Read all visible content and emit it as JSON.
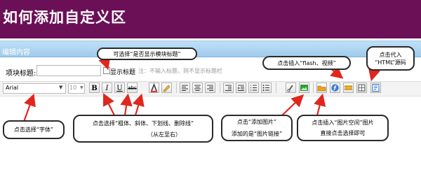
{
  "header": {
    "title": "如何添加自定义区"
  },
  "panel": {
    "tab_label": "编辑内容"
  },
  "form": {
    "title_label": "项块标题:",
    "title_value": "",
    "show_title_label": "显示标题",
    "show_title_checked": false,
    "note": "注：不输入标题，则不显示标题栏"
  },
  "toolbar": {
    "font_value": "Arial",
    "size_value": "10",
    "bold": "B",
    "italic": "I",
    "underline": "U",
    "strike": "abc"
  },
  "callouts": {
    "show_title": "可选择“是否显示模块标题”",
    "insert_flash": "点击插入“flash、视频”",
    "insert_html_1": "点击代入",
    "insert_html_2": "“HTML”源码",
    "font_select": "点击选择“字体”",
    "text_style_1": "点击选择“粗体、斜体、下划线、删除线”",
    "text_style_2": "（从左至右）",
    "add_image_1": "点击“添加图片”",
    "add_image_2": "添加的是“图片链接”",
    "image_space_1": "点击插入“图片空间”图片",
    "image_space_2": "直接点击选择即可"
  },
  "colors": {
    "header_bg": "#6b1057",
    "tab_bg": "#a8d0ef",
    "image_icon": "#2e9b3a",
    "html_icon": "#2b6cc4"
  }
}
